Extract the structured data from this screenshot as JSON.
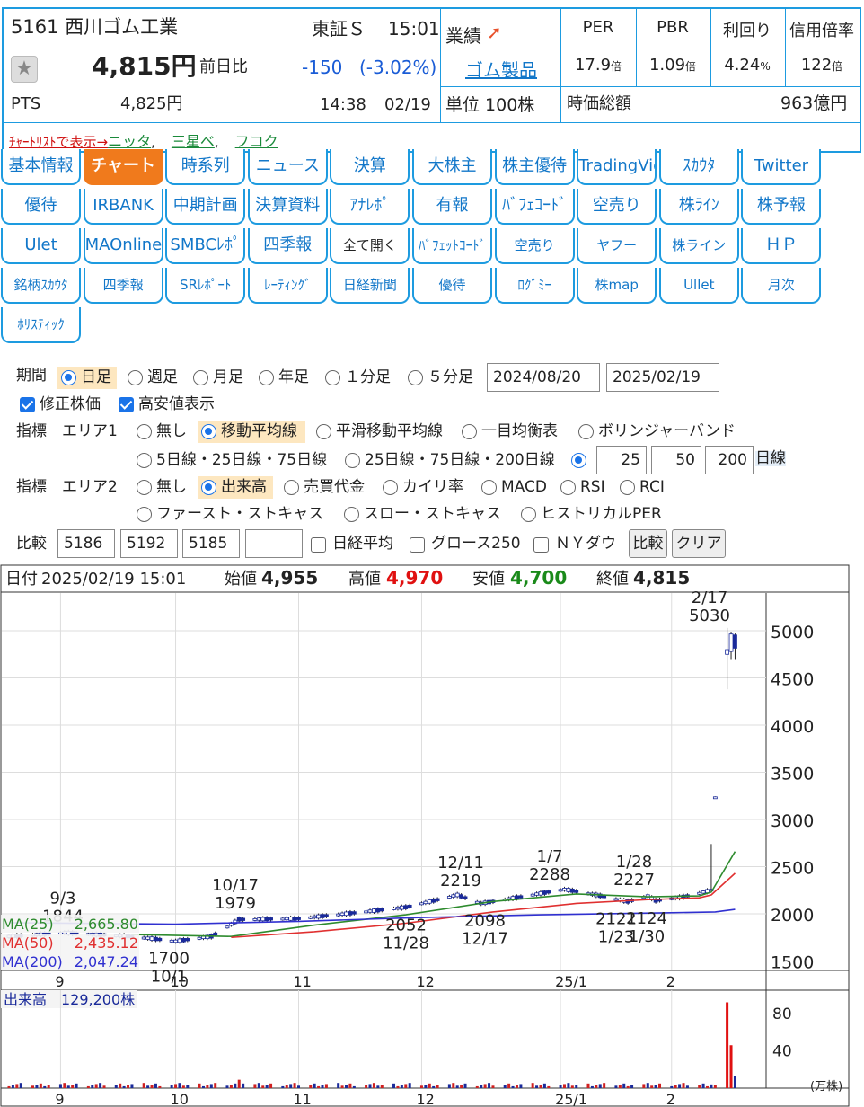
{
  "stock": {
    "code_name": "5161 西川ゴム工業",
    "market": "東証Ｓ",
    "time": "15:01",
    "price": "4,815円",
    "prev_label": "前日比",
    "change": "-150",
    "change_pct": "(-3.02%)",
    "pts_label": "PTS",
    "pts_price": "4,825円",
    "pts_time": "14:38",
    "pts_date": "02/19",
    "gyoseki_label": "業績",
    "sector_link": "ゴム製品",
    "unit": "単位 100株",
    "market_cap_label": "時価総額",
    "market_cap": "963億円",
    "metrics": [
      {
        "label": "PER",
        "value": "17.9",
        "unit": "倍"
      },
      {
        "label": "PBR",
        "value": "1.09",
        "unit": "倍"
      },
      {
        "label": "利回り",
        "value": "4.24",
        "unit": "%"
      },
      {
        "label": "信用倍率",
        "value": "122",
        "unit": "倍"
      }
    ],
    "chartlist_label": "ﾁｬｰﾄﾘｽﾄで表示→",
    "chartlist_links": [
      "ニッタ",
      "三星ベ",
      "フコク"
    ]
  },
  "nav": {
    "rows": [
      [
        "基本情報",
        "チャート",
        "時系列",
        "ニュース",
        "決算",
        "大株主",
        "株主優待",
        "TradingVie",
        "ｽｶｳﾀ",
        "Twitter"
      ],
      [
        "優待",
        "IRBANK",
        "中期計画",
        "決算資料",
        "ｱﾅﾚﾎﾟ",
        "有報",
        "ﾊﾞﾌｪｺｰﾄﾞ",
        "空売り",
        "株ﾗｲﾝ",
        "株予報"
      ],
      [
        "Ulet",
        "MAOnline",
        "SMBCﾚﾎﾟ",
        "四季報",
        "全て開く",
        "ﾊﾞﾌｪｯﾄｺｰﾄﾞ",
        "空売り",
        "ヤフー",
        "株ライン",
        "ＨＰ"
      ],
      [
        "銘柄ｽｶｳﾀ",
        "四季報",
        "SRﾚﾎﾟｰﾄ",
        "ﾚｰﾃｨﾝｸﾞ",
        "日経新聞",
        "優待",
        "ﾛｸﾞﾐｰ",
        "株map",
        "Ullet",
        "月次"
      ],
      [
        "ﾎﾘｽﾃｨｯｸ"
      ]
    ]
  },
  "form": {
    "period_label": "期間",
    "periods": [
      "日足",
      "週足",
      "月足",
      "年足",
      "１分足",
      "５分足"
    ],
    "date_from": "2024/08/20",
    "date_to": "2025/02/19",
    "adjusted": "修正株価",
    "show_hilo": "高安値表示",
    "ind1_label": "指標　エリア1",
    "ind1": [
      "無し",
      "移動平均線",
      "平滑移動平均線",
      "一目均衡表",
      "ボリンジャーバンド"
    ],
    "ind1_b": [
      "5日線・25日線・75日線",
      "25日線・75日線・200日線"
    ],
    "ma_values": [
      "25",
      "50",
      "200"
    ],
    "ma_unit": "日線",
    "ind2_label": "指標　エリア2",
    "ind2": [
      "無し",
      "出来高",
      "売買代金",
      "カイリ率",
      "MACD",
      "RSI",
      "RCI"
    ],
    "ind2_b": [
      "ファースト・ストキャス",
      "スロー・ストキャス",
      "ヒストリカルPER"
    ],
    "compare_label": "比較",
    "compare_codes": [
      "5186",
      "5192",
      "5185",
      ""
    ],
    "compare_checks": [
      "日経平均",
      "グロース250",
      "ＮＹダウ"
    ],
    "compare_btn": "比較",
    "clear_btn": "クリア"
  },
  "ohlc": {
    "date_label": "日付",
    "date": "2025/02/19 15:01",
    "open_label": "始値",
    "open": "4,955",
    "high_label": "高値",
    "high": "4,970",
    "low_label": "安値",
    "low": "4,700",
    "close_label": "終値",
    "close": "4,815"
  },
  "chart_data": {
    "type": "candlestick",
    "ylim": [
      1400,
      5400
    ],
    "yticks": [
      1500,
      2000,
      2500,
      3000,
      3500,
      4000,
      4500,
      5000
    ],
    "xticks": [
      {
        "label": "9",
        "day": "2024-09-02"
      },
      {
        "label": "10",
        "day": "2024-10-01"
      },
      {
        "label": "11",
        "day": "2024-11-01"
      },
      {
        "label": "12",
        "day": "2024-12-02"
      },
      {
        "label": "25/1",
        "day": "2025-01-06"
      },
      {
        "label": "2",
        "day": "2025-02-03"
      }
    ],
    "x_start": "2024-08-20",
    "x_end": "2025-02-19",
    "annotations": [
      {
        "date": "9/3",
        "value": "1844"
      },
      {
        "date": "10/1",
        "value": "1700"
      },
      {
        "date": "10/17",
        "value": "1979"
      },
      {
        "date": "11/28",
        "value": "2052"
      },
      {
        "date": "12/11",
        "value": "2219"
      },
      {
        "date": "12/17",
        "value": "2098"
      },
      {
        "date": "1/7",
        "value": "2288"
      },
      {
        "date": "1/23",
        "value": "2121"
      },
      {
        "date": "1/28",
        "value": "2227"
      },
      {
        "date": "1/30",
        "value": "2124"
      },
      {
        "date": "2/17",
        "value": "5030"
      }
    ],
    "series": [
      {
        "name": "MA(25)",
        "color": "#2e8b2e",
        "last": "2,665.80"
      },
      {
        "name": "MA(50)",
        "color": "#e03030",
        "last": "2,435.12"
      },
      {
        "name": "MA(200)",
        "color": "#3030d0",
        "last": "2,047.24"
      }
    ],
    "volume_label": "出来高",
    "volume_value": "129,200株",
    "volume_unit": "(万株)",
    "volume_yticks": [
      40,
      80
    ],
    "volume_ylim": [
      0,
      105
    ]
  }
}
